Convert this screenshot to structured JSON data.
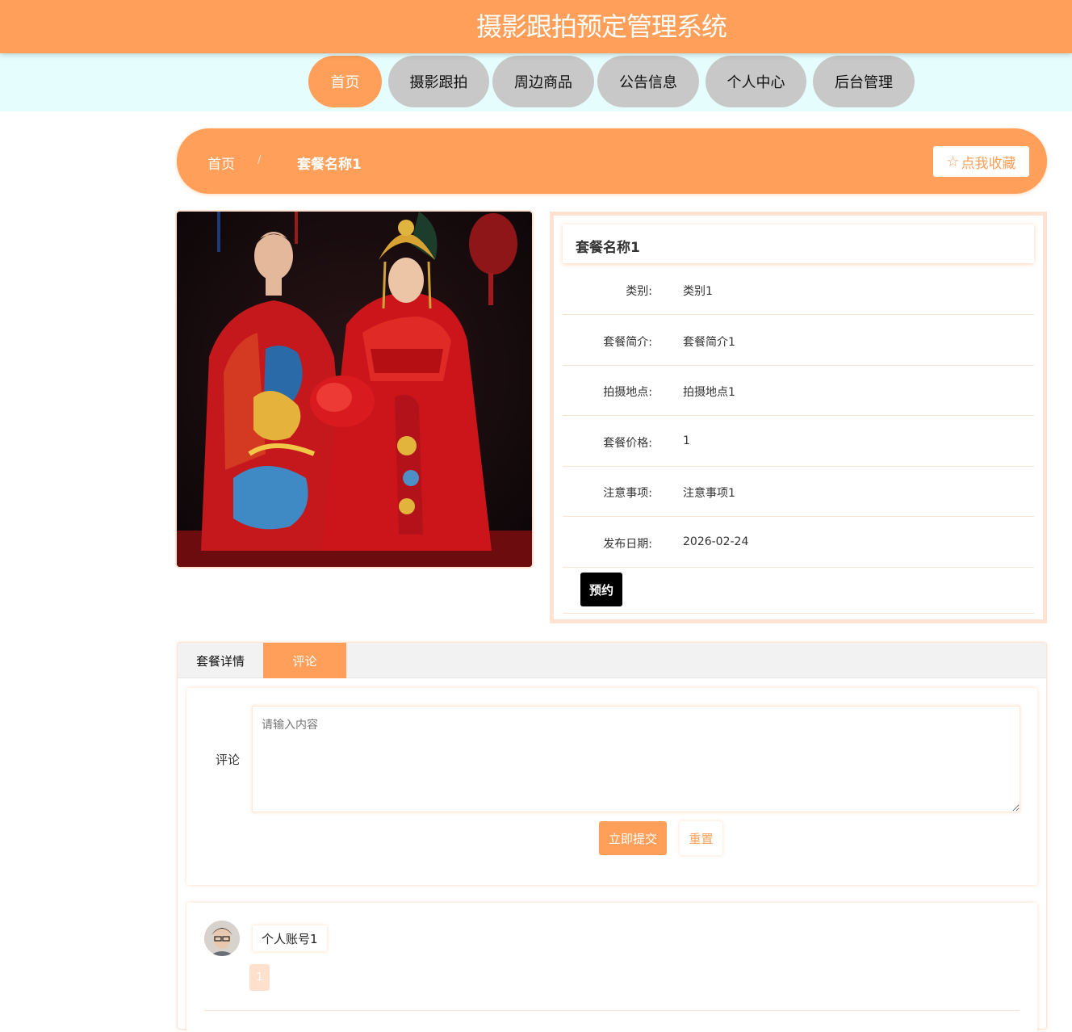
{
  "app": {
    "title": "摄影跟拍预定管理系统"
  },
  "nav": {
    "items": [
      {
        "label": "首页",
        "active": true
      },
      {
        "label": "摄影跟拍",
        "active": false
      },
      {
        "label": "周边商品",
        "active": false
      },
      {
        "label": "公告信息",
        "active": false
      },
      {
        "label": "个人中心",
        "active": false
      },
      {
        "label": "后台管理",
        "active": false
      }
    ]
  },
  "breadcrumb": {
    "home": "首页",
    "separator": "/",
    "current": "套餐名称1"
  },
  "favorite": {
    "icon": "star-outline-icon",
    "label": "点我收藏"
  },
  "package": {
    "name": "套餐名称1",
    "fields": [
      {
        "label": "类别:",
        "value": "类别1"
      },
      {
        "label": "套餐简介:",
        "value": "套餐简介1"
      },
      {
        "label": "拍摄地点:",
        "value": "拍摄地点1"
      },
      {
        "label": "套餐价格:",
        "value": "1"
      },
      {
        "label": "注意事项:",
        "value": "注意事项1"
      },
      {
        "label": "发布日期:",
        "value": "2026-02-24"
      }
    ],
    "book_label": "预约"
  },
  "tabs": [
    {
      "label": "套餐详情",
      "active": false
    },
    {
      "label": "评论",
      "active": true
    }
  ],
  "comment_form": {
    "label": "评论",
    "placeholder": "请输入内容",
    "submit_label": "立即提交",
    "reset_label": "重置"
  },
  "comments": [
    {
      "user": "个人账号1",
      "content": "1"
    }
  ],
  "colors": {
    "accent": "#ff9f59",
    "nav_bg": "#e6fdfd",
    "nav_inactive": "#c8c8c8",
    "panel_border": "#ffe2d2"
  }
}
